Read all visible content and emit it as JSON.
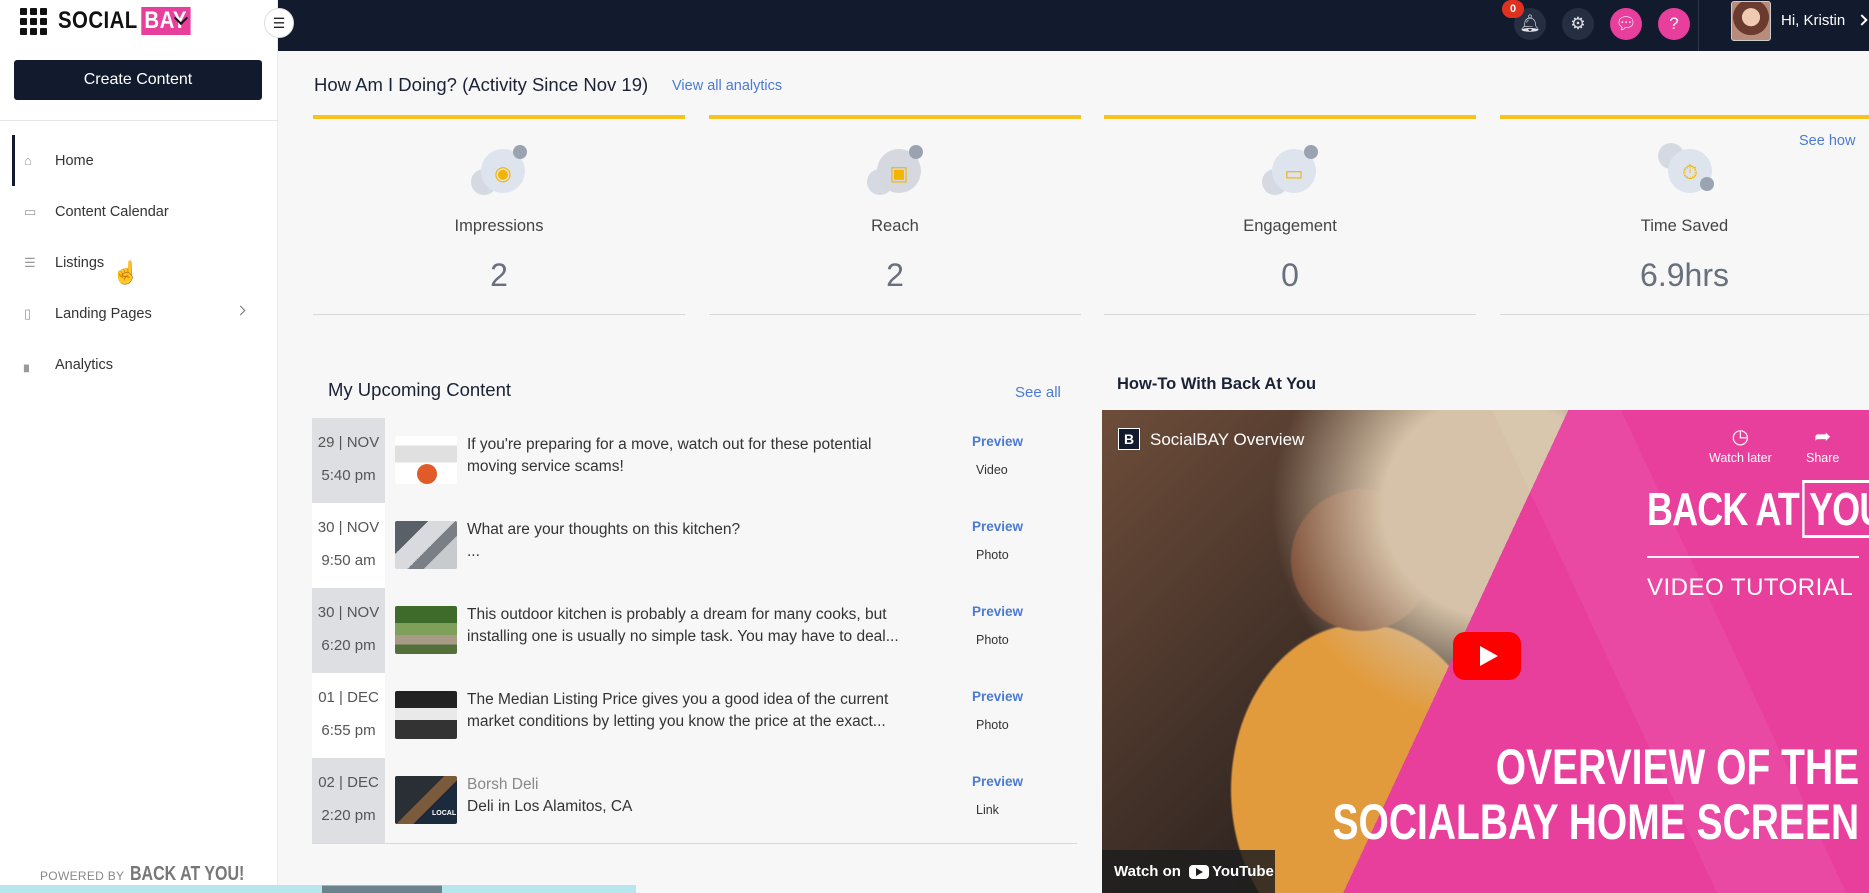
{
  "brand": {
    "name_left": "SOCIAL",
    "name_right": "BAY"
  },
  "sidebar": {
    "create_label": "Create Content",
    "items": [
      {
        "label": "Home",
        "icon": "home-icon"
      },
      {
        "label": "Content Calendar",
        "icon": "calendar-icon"
      },
      {
        "label": "Listings",
        "icon": "listings-icon"
      },
      {
        "label": "Landing Pages",
        "icon": "pages-icon"
      },
      {
        "label": "Analytics",
        "icon": "analytics-icon"
      }
    ],
    "powered_prefix": "POWERED BY",
    "powered_brand": "BACK AT YOU!"
  },
  "topbar": {
    "notification_count": "0",
    "greeting": "Hi, Kristin",
    "icons": [
      "bell-icon",
      "gear-icon",
      "chat-icon",
      "help-icon"
    ]
  },
  "activity": {
    "title": "How Am I Doing? (Activity Since Nov 19)",
    "view_all": "View all analytics",
    "see_how": "See how",
    "stats": [
      {
        "label": "Impressions",
        "value": "2"
      },
      {
        "label": "Reach",
        "value": "2"
      },
      {
        "label": "Engagement",
        "value": "0"
      },
      {
        "label": "Time Saved",
        "value": "6.9hrs"
      }
    ]
  },
  "upcoming": {
    "title": "My Upcoming Content",
    "see_all": "See all",
    "preview_label": "Preview",
    "rows": [
      {
        "date": "29 | NOV",
        "time": "5:40 pm",
        "text": "If you're preparing for a move, watch out for these potential moving service scams!",
        "type": "Video"
      },
      {
        "date": "30 | NOV",
        "time": "9:50 am",
        "text": "What are your thoughts on this kitchen?",
        "sub": "...",
        "type": "Photo"
      },
      {
        "date": "30 | NOV",
        "time": "6:20 pm",
        "text": "This outdoor kitchen is probably a dream for many cooks, but installing one is usually no simple task. You may have to deal...",
        "type": "Photo"
      },
      {
        "date": "01 | DEC",
        "time": "6:55 pm",
        "text": "The Median Listing Price gives you a good idea of the current market conditions by letting you know the price at the exact...",
        "type": "Photo"
      },
      {
        "date": "02 | DEC",
        "time": "2:20 pm",
        "title": "Borsh Deli",
        "text": "Deli in Los Alamitos, CA",
        "type": "Link",
        "thumb_tag": "LOCAL"
      }
    ]
  },
  "howto": {
    "title": "How-To With Back At You",
    "video": {
      "logo_letter": "B",
      "title": "SocialBAY Overview",
      "watch_later": "Watch later",
      "share": "Share",
      "brand_left": "BACK AT",
      "brand_box": "YOU!",
      "subtitle": "VIDEO TUTORIAL",
      "headline_1": "OVERVIEW OF THE",
      "headline_2": "SOCIALBAY HOME SCREEN",
      "watch_on": "Watch on",
      "youtube": "YouTube"
    }
  }
}
